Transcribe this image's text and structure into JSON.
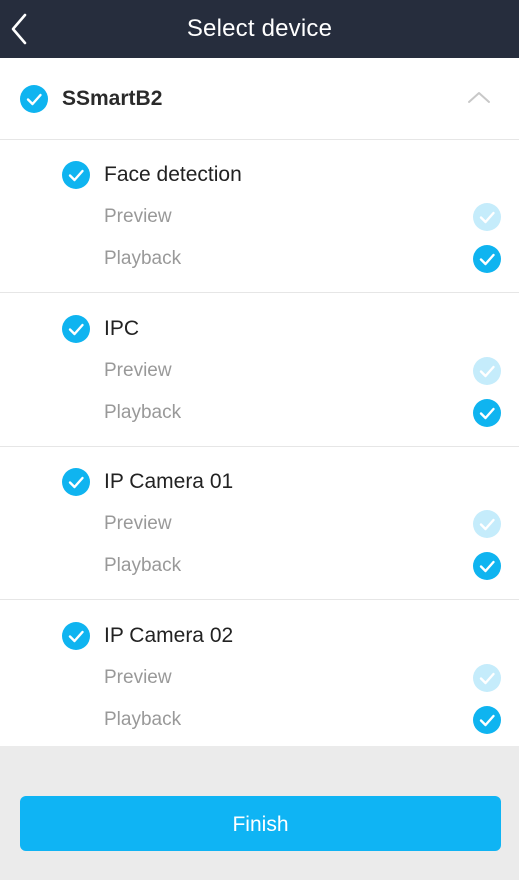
{
  "header": {
    "title": "Select device"
  },
  "device": {
    "name": "SSmartB2",
    "checked": true,
    "expanded": true
  },
  "channels": [
    {
      "name": "Face detection",
      "checked": true,
      "preview": {
        "label": "Preview",
        "checked": true,
        "enabled": false
      },
      "playback": {
        "label": "Playback",
        "checked": true,
        "enabled": true
      }
    },
    {
      "name": "IPC",
      "checked": true,
      "preview": {
        "label": "Preview",
        "checked": true,
        "enabled": false
      },
      "playback": {
        "label": "Playback",
        "checked": true,
        "enabled": true
      }
    },
    {
      "name": "IP Camera 01",
      "checked": true,
      "preview": {
        "label": "Preview",
        "checked": true,
        "enabled": false
      },
      "playback": {
        "label": "Playback",
        "checked": true,
        "enabled": true
      }
    },
    {
      "name": "IP Camera 02",
      "checked": true,
      "preview": {
        "label": "Preview",
        "checked": true,
        "enabled": false
      },
      "playback": {
        "label": "Playback",
        "checked": true,
        "enabled": true
      }
    }
  ],
  "footer": {
    "finish_label": "Finish"
  },
  "colors": {
    "accent": "#0fb4f0",
    "accent_disabled": "#c5ecfb",
    "header_bg": "#262d3d"
  }
}
